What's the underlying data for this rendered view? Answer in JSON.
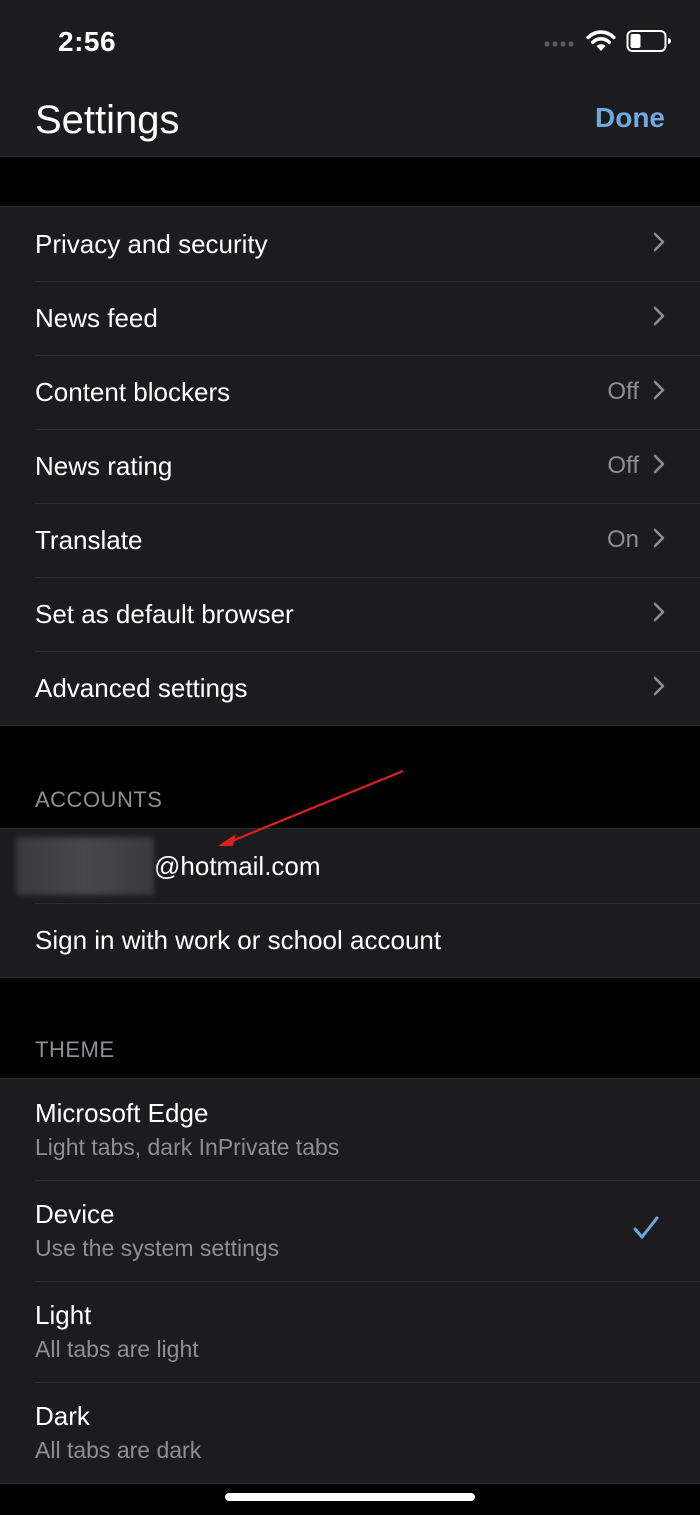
{
  "status_bar": {
    "time": "2:56",
    "icons": [
      "cellular-signal-icon",
      "wifi-icon",
      "battery-icon"
    ]
  },
  "header": {
    "title": "Settings",
    "done_label": "Done"
  },
  "colors": {
    "accent": "#6fa8dc",
    "background": "#000000",
    "surface": "#1c1c1e",
    "secondary_text": "#8e8e93",
    "annotation": "#e02020"
  },
  "settings": {
    "items": [
      {
        "label": "Privacy and security",
        "value": ""
      },
      {
        "label": "News feed",
        "value": ""
      },
      {
        "label": "Content blockers",
        "value": "Off"
      },
      {
        "label": "News rating",
        "value": "Off"
      },
      {
        "label": "Translate",
        "value": "On"
      },
      {
        "label": "Set as default browser",
        "value": ""
      },
      {
        "label": "Advanced settings",
        "value": ""
      }
    ]
  },
  "accounts": {
    "header": "ACCOUNTS",
    "email_suffix": "@hotmail.com",
    "sign_in_label": "Sign in with work or school account"
  },
  "theme": {
    "header": "THEME",
    "options": [
      {
        "title": "Microsoft Edge",
        "subtitle": "Light tabs, dark InPrivate tabs"
      },
      {
        "title": "Device",
        "subtitle": "Use the system settings"
      },
      {
        "title": "Light",
        "subtitle": "All tabs are light"
      },
      {
        "title": "Dark",
        "subtitle": "All tabs are dark"
      }
    ],
    "selected": "Device"
  }
}
